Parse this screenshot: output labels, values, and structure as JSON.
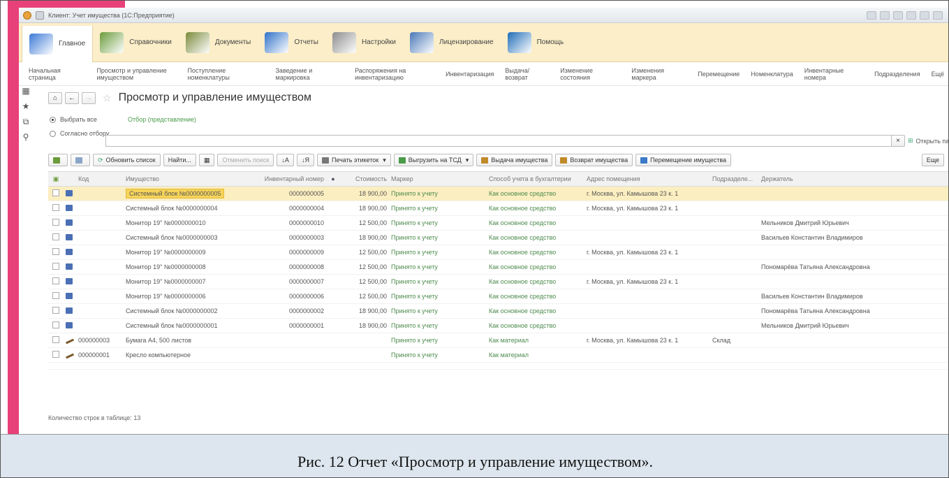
{
  "window": {
    "title": "Клиент: Учет имущества (1С:Предприятие)"
  },
  "sections": [
    {
      "label": "Главное",
      "icon": "home-section-icon",
      "color": "#3c7ad6"
    },
    {
      "label": "Справочники",
      "icon": "catalogs-section-icon",
      "color": "#6a9c3a"
    },
    {
      "label": "Документы",
      "icon": "documents-section-icon",
      "color": "#7a8a3a"
    },
    {
      "label": "Отчеты",
      "icon": "reports-section-icon",
      "color": "#2f72c9"
    },
    {
      "label": "Настройки",
      "icon": "settings-section-icon",
      "color": "#8c8c8c"
    },
    {
      "label": "Лицензирование",
      "icon": "licensing-section-icon",
      "color": "#4a78b8"
    },
    {
      "label": "Помощь",
      "icon": "help-section-icon",
      "color": "#1f6cb8"
    }
  ],
  "nav": [
    "Начальная страница",
    "Просмотр и управление имуществом",
    "Поступление номенклатуры",
    "Заведение и маркировка",
    "Распоряжения на инвентаризацию",
    "Инвентаризация",
    "Выдача/возврат",
    "Изменение состояния",
    "Изменения маркера",
    "Перемещение",
    "Номенклатура",
    "Инвентарные номера",
    "Подразделения",
    "Ещё"
  ],
  "page": {
    "title": "Просмотр и управление имуществом"
  },
  "filter": {
    "select_all": "Выбрать все",
    "by_selection": "Согласно отбору",
    "selection_link": "Отбор (представление)",
    "open_panel": "Открыть панель отбо"
  },
  "toolbar": {
    "refresh": "Обновить список",
    "find": "Найти...",
    "cancel_search": "Отменить поиск",
    "print_labels": "Печать этикеток",
    "upload_tsd": "Выгрузить на ТСД",
    "issue": "Выдача имущества",
    "return": "Возврат имущества",
    "move": "Перемещение имущества",
    "more": "Еще"
  },
  "table": {
    "columns": [
      "Код",
      "Имущество",
      "Инвентарный номер",
      "Стоимость",
      "Маркер",
      "Способ учета в бухгалтерии",
      "Адрес помещения",
      "Подразделе...",
      "Держатель"
    ],
    "rows": [
      {
        "code": "",
        "item": "Системный блок №0000000005",
        "inv": "0000000005",
        "cost": "18 900,00",
        "marker": "Принято к учету",
        "method": "Как основное средство",
        "address": "г. Москва, ул. Камышова 23 к. 1",
        "dept": "",
        "holder": "",
        "selected": true
      },
      {
        "code": "",
        "item": "Системный блок №0000000004",
        "inv": "0000000004",
        "cost": "18 900,00",
        "marker": "Принято к учету",
        "method": "Как основное средство",
        "address": "г. Москва, ул. Камышова 23 к. 1",
        "dept": "",
        "holder": ""
      },
      {
        "code": "",
        "item": "Монитор 19\" №0000000010",
        "inv": "0000000010",
        "cost": "12 500,00",
        "marker": "Принято к учету",
        "method": "Как основное средство",
        "address": "",
        "dept": "",
        "holder": "Мельников Дмитрий Юрьевич"
      },
      {
        "code": "",
        "item": "Системный блок №0000000003",
        "inv": "0000000003",
        "cost": "18 900,00",
        "marker": "Принято к учету",
        "method": "Как основное средство",
        "address": "",
        "dept": "",
        "holder": "Васильев Константин Владимиров"
      },
      {
        "code": "",
        "item": "Монитор 19\" №0000000009",
        "inv": "0000000009",
        "cost": "12 500,00",
        "marker": "Принято к учету",
        "method": "Как основное средство",
        "address": "г. Москва, ул. Камышова 23 к. 1",
        "dept": "",
        "holder": ""
      },
      {
        "code": "",
        "item": "Монитор 19\" №0000000008",
        "inv": "0000000008",
        "cost": "12 500,00",
        "marker": "Принято к учету",
        "method": "Как основное средство",
        "address": "",
        "dept": "",
        "holder": "Пономарёва Татьяна Александровна"
      },
      {
        "code": "",
        "item": "Монитор 19\" №0000000007",
        "inv": "0000000007",
        "cost": "12 500,00",
        "marker": "Принято к учету",
        "method": "Как основное средство",
        "address": "г. Москва, ул. Камышова 23 к. 1",
        "dept": "",
        "holder": ""
      },
      {
        "code": "",
        "item": "Монитор 19\" №0000000006",
        "inv": "0000000006",
        "cost": "12 500,00",
        "marker": "Принято к учету",
        "method": "Как основное средство",
        "address": "",
        "dept": "",
        "holder": "Васильев Константин Владимиров"
      },
      {
        "code": "",
        "item": "Системный блок №0000000002",
        "inv": "0000000002",
        "cost": "18 900,00",
        "marker": "Принято к учету",
        "method": "Как основное средство",
        "address": "",
        "dept": "",
        "holder": "Пономарёва Татьяна Александровна"
      },
      {
        "code": "",
        "item": "Системный блок №0000000001",
        "inv": "0000000001",
        "cost": "18 900,00",
        "marker": "Принято к учету",
        "method": "Как основное средство",
        "address": "",
        "dept": "",
        "holder": "Мельников Дмитрий Юрьевич"
      },
      {
        "code": "000000003",
        "item": "Бумага А4, 500 листов",
        "inv": "",
        "cost": "",
        "marker": "Принято к учету",
        "method": "Как материал",
        "address": "г. Москва, ул. Камышова 23 к. 1",
        "dept": "Склад",
        "holder": ""
      },
      {
        "code": "000000001",
        "item": "Кресло компьютерное",
        "inv": "",
        "cost": "",
        "marker": "Принято к учету",
        "method": "Как материал",
        "address": "",
        "dept": "",
        "holder": ""
      }
    ]
  },
  "footer": {
    "count_label": "Количество строк в таблице:",
    "count": "13"
  },
  "caption": "Рис. 12 Отчет «Просмотр и управление имуществом»."
}
